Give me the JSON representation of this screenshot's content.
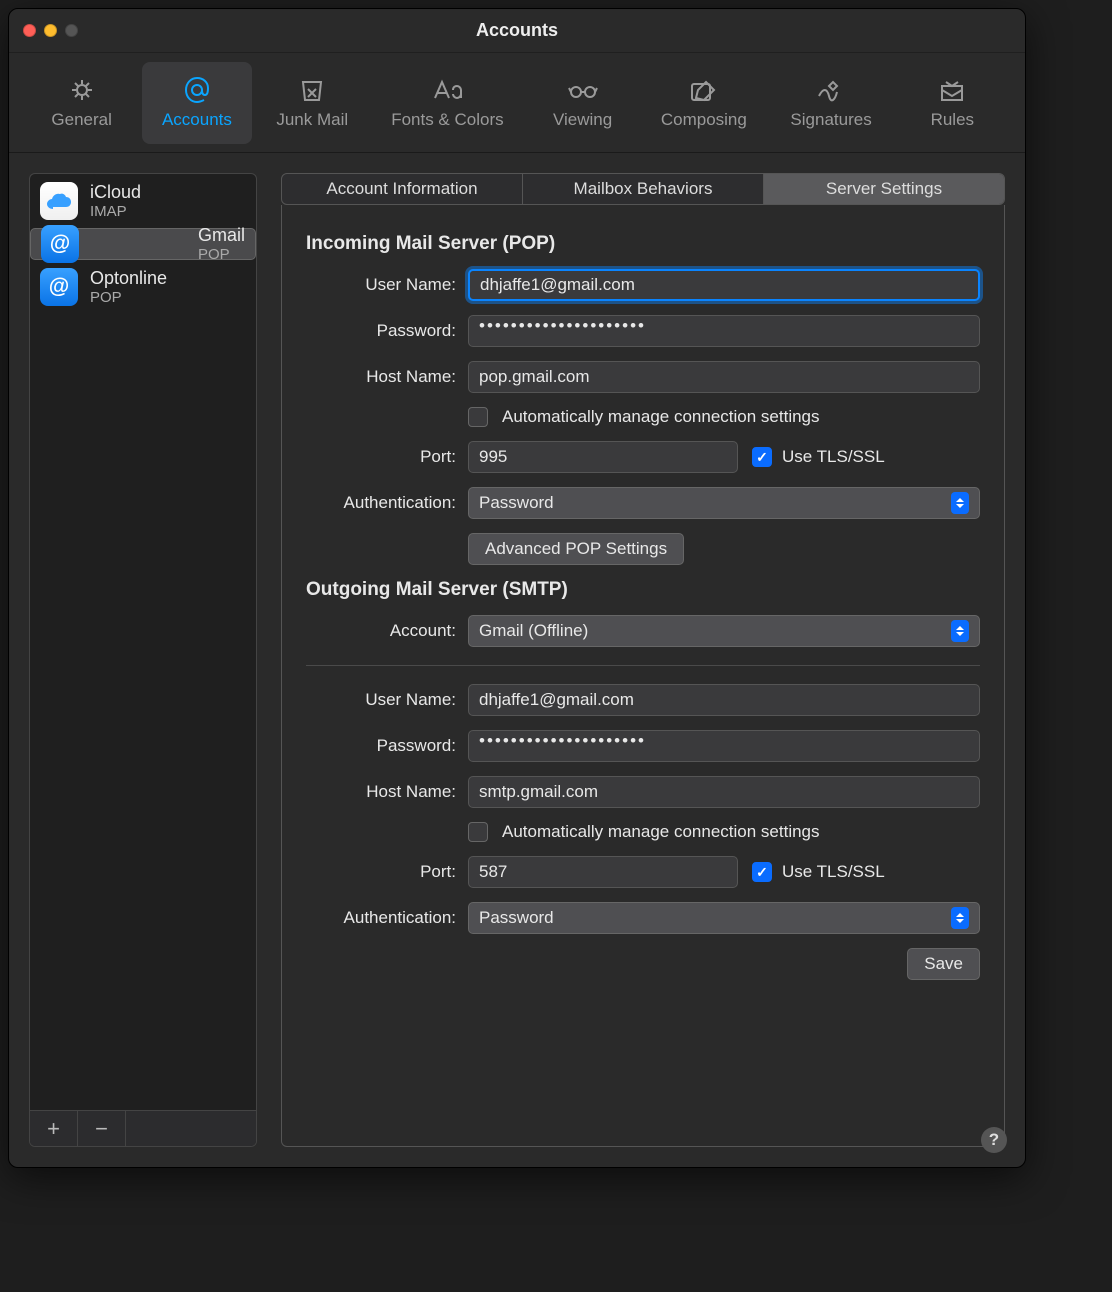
{
  "window": {
    "title": "Accounts"
  },
  "toolbar": {
    "items": [
      {
        "label": "General"
      },
      {
        "label": "Accounts"
      },
      {
        "label": "Junk Mail"
      },
      {
        "label": "Fonts & Colors"
      },
      {
        "label": "Viewing"
      },
      {
        "label": "Composing"
      },
      {
        "label": "Signatures"
      },
      {
        "label": "Rules"
      }
    ],
    "active_index": 1
  },
  "sidebar": {
    "accounts": [
      {
        "name": "iCloud",
        "type": "IMAP"
      },
      {
        "name": "Gmail",
        "type": "POP"
      },
      {
        "name": "Optonline",
        "type": "POP"
      }
    ],
    "selected_index": 1,
    "add_glyph": "+",
    "remove_glyph": "−"
  },
  "tabs": {
    "items": [
      "Account Information",
      "Mailbox Behaviors",
      "Server Settings"
    ],
    "active_index": 2
  },
  "incoming": {
    "section_title": "Incoming Mail Server (POP)",
    "username_label": "User Name:",
    "username": "dhjaffe1@gmail.com",
    "password_label": "Password:",
    "password": "•••••••••••••••••••••",
    "hostname_label": "Host Name:",
    "hostname": "pop.gmail.com",
    "auto_label": "Automatically manage connection settings",
    "auto_checked": false,
    "port_label": "Port:",
    "port": "995",
    "tls_label": "Use TLS/SSL",
    "tls_checked": true,
    "auth_label": "Authentication:",
    "auth_value": "Password",
    "advanced_button": "Advanced POP Settings"
  },
  "outgoing": {
    "section_title": "Outgoing Mail Server (SMTP)",
    "account_label": "Account:",
    "account_value": "Gmail (Offline)",
    "username_label": "User Name:",
    "username": "dhjaffe1@gmail.com",
    "password_label": "Password:",
    "password": "•••••••••••••••••••••",
    "hostname_label": "Host Name:",
    "hostname": "smtp.gmail.com",
    "auto_label": "Automatically manage connection settings",
    "auto_checked": false,
    "port_label": "Port:",
    "port": "587",
    "tls_label": "Use TLS/SSL",
    "tls_checked": true,
    "auth_label": "Authentication:",
    "auth_value": "Password"
  },
  "buttons": {
    "save": "Save",
    "help": "?"
  }
}
